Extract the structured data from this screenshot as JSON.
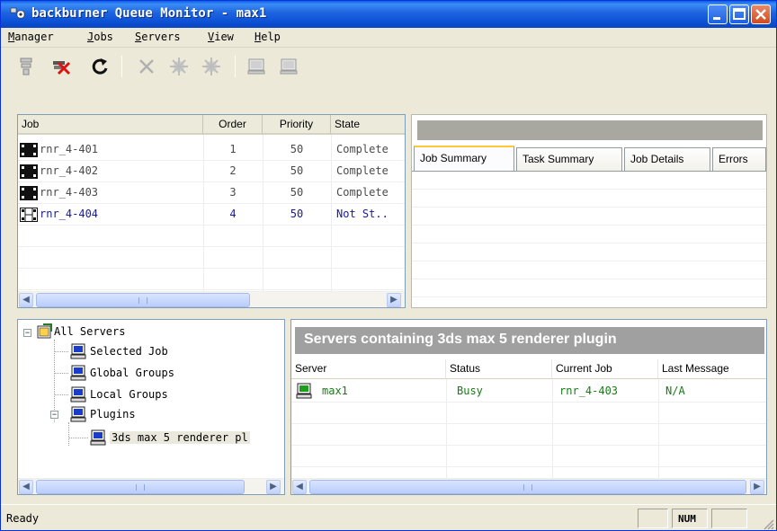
{
  "window": {
    "title": "backburner Queue Monitor - max1"
  },
  "menu": {
    "items": [
      {
        "label": "Manager",
        "mnemonic": "M",
        "rest": "anager"
      },
      {
        "label": "Jobs",
        "mnemonic": "J",
        "rest": "obs"
      },
      {
        "label": "Servers",
        "mnemonic": "S",
        "rest": "ervers"
      },
      {
        "label": "View",
        "mnemonic": "V",
        "rest": "iew"
      },
      {
        "label": "Help",
        "mnemonic": "H",
        "rest": "elp"
      }
    ]
  },
  "toolbar": {
    "icons": [
      "disconnect-icon",
      "delete-job-icon",
      "refresh-icon",
      "remove-icon",
      "activate-icon",
      "deactivate-icon",
      "server-icon-1",
      "server-icon-2"
    ]
  },
  "jobs": {
    "columns": [
      "Job",
      "Order",
      "Priority",
      "State"
    ],
    "rows": [
      {
        "name": "rnr_4-401",
        "order": "1",
        "priority": "50",
        "state": "Complete",
        "selected": false
      },
      {
        "name": "rnr_4-402",
        "order": "2",
        "priority": "50",
        "state": "Complete",
        "selected": false
      },
      {
        "name": "rnr_4-403",
        "order": "3",
        "priority": "50",
        "state": "Complete",
        "selected": false
      },
      {
        "name": "rnr_4-404",
        "order": "4",
        "priority": "50",
        "state": "Not St..",
        "selected": true
      }
    ]
  },
  "job_detail": {
    "tabs": [
      "Job Summary",
      "Task Summary",
      "Job Details",
      "Errors"
    ]
  },
  "server_tree": {
    "root": "All Servers",
    "items": [
      "Selected Job",
      "Global Groups",
      "Local Groups",
      "Plugins",
      "3ds max 5 renderer pl"
    ]
  },
  "servers_panel": {
    "heading": "Servers containing 3ds max 5 renderer plugin",
    "columns": [
      "Server",
      "Status",
      "Current Job",
      "Last Message"
    ],
    "rows": [
      {
        "server": "max1",
        "status": "Busy",
        "current_job": "rnr_4-403",
        "last_message": "N/A"
      }
    ]
  },
  "status_bar": {
    "text": "Ready",
    "num": "NUM"
  },
  "colors": {
    "title_blue": "#0b4fd3",
    "busy_green": "#1a7a1a",
    "header_gray": "#a0a0a0",
    "selected_blue": "#1a1a8a"
  }
}
